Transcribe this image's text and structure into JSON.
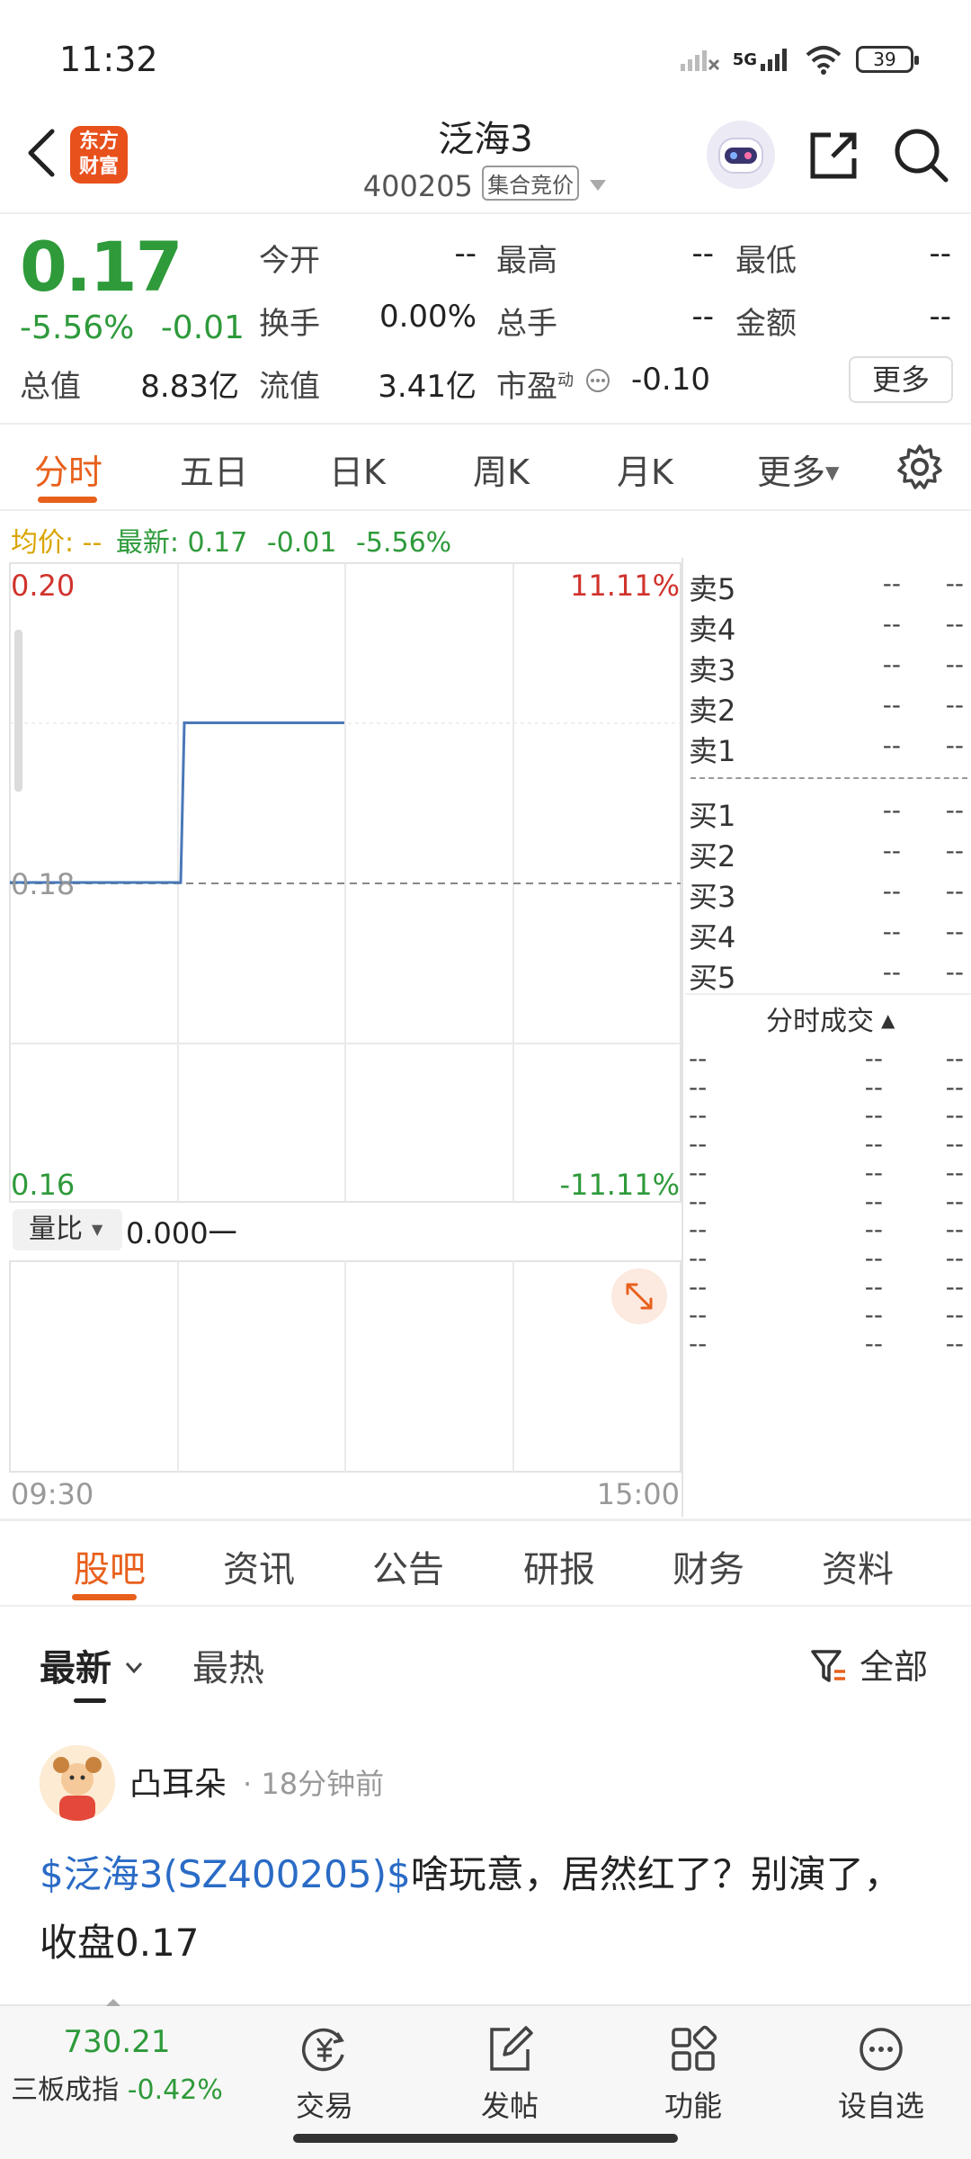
{
  "status_bar": {
    "time": "11:32",
    "network": "5G",
    "battery": "39"
  },
  "header": {
    "logo_line1": "东方",
    "logo_line2": "财富",
    "title": "泛海3",
    "code": "400205",
    "mode_tag": "集合竞价"
  },
  "quote": {
    "price": "0.17",
    "change_pct": "-5.56%",
    "change_amt": "-0.01",
    "fields": {
      "open_label": "今开",
      "open_value": "--",
      "high_label": "最高",
      "high_value": "--",
      "low_label": "最低",
      "low_value": "--",
      "turnover_label": "换手",
      "turnover_value": "0.00%",
      "volume_label": "总手",
      "volume_value": "--",
      "amount_label": "金额",
      "amount_value": "--",
      "mktcap_label": "总值",
      "mktcap_value": "8.83亿",
      "float_label": "流值",
      "float_value": "3.41亿",
      "pe_label": "市盈",
      "pe_sup": "动",
      "pe_value": "-0.10"
    },
    "more_label": "更多"
  },
  "chart_tabs": [
    "分时",
    "五日",
    "日K",
    "周K",
    "月K",
    "更多"
  ],
  "info_line": {
    "avg_label": "均价:",
    "avg_value": "--",
    "latest_label": "最新:",
    "latest_value": "0.17",
    "latest_change": "-0.01",
    "latest_pct": "-5.56%"
  },
  "chart_data": {
    "type": "line",
    "x": [
      "09:30",
      "09:30",
      "10:30",
      "11:30"
    ],
    "series": [
      {
        "values": [
          0.18,
          0.19,
          0.19,
          0.19
        ]
      }
    ],
    "ylim": [
      0.16,
      0.2
    ],
    "y_tick_labels_left": [
      "0.20",
      "0.18",
      "0.16"
    ],
    "y_tick_labels_right": [
      "11.11%",
      "-11.11%"
    ],
    "reference_value": 0.18,
    "x_tick_labels": [
      "09:30",
      "15:00"
    ],
    "grid": true
  },
  "volume_panel": {
    "label": "量比",
    "value": "0.000",
    "suffix": "一"
  },
  "order_book": {
    "asks": [
      {
        "label": "卖5",
        "price": "--",
        "qty": "--"
      },
      {
        "label": "卖4",
        "price": "--",
        "qty": "--"
      },
      {
        "label": "卖3",
        "price": "--",
        "qty": "--"
      },
      {
        "label": "卖2",
        "price": "--",
        "qty": "--"
      },
      {
        "label": "卖1",
        "price": "--",
        "qty": "--"
      }
    ],
    "bids": [
      {
        "label": "买1",
        "price": "--",
        "qty": "--"
      },
      {
        "label": "买2",
        "price": "--",
        "qty": "--"
      },
      {
        "label": "买3",
        "price": "--",
        "qty": "--"
      },
      {
        "label": "买4",
        "price": "--",
        "qty": "--"
      },
      {
        "label": "买5",
        "price": "--",
        "qty": "--"
      }
    ],
    "trades_title": "分时成交",
    "trades": [
      [
        "--",
        "--",
        "--"
      ],
      [
        "--",
        "--",
        "--"
      ],
      [
        "--",
        "--",
        "--"
      ],
      [
        "--",
        "--",
        "--"
      ],
      [
        "--",
        "--",
        "--"
      ],
      [
        "--",
        "--",
        "--"
      ],
      [
        "--",
        "--",
        "--"
      ],
      [
        "--",
        "--",
        "--"
      ],
      [
        "--",
        "--",
        "--"
      ],
      [
        "--",
        "--",
        "--"
      ],
      [
        "--",
        "--",
        "--"
      ]
    ]
  },
  "content_tabs": [
    "股吧",
    "资讯",
    "公告",
    "研报",
    "财务",
    "资料"
  ],
  "feed": {
    "sort_new": "最新",
    "sort_hot": "最热",
    "filter_label": "全部",
    "post": {
      "user": "凸耳朵",
      "time": "18分钟前",
      "link_text": "$泛海3(SZ400205)$",
      "text": "啥玩意，居然红了？别演了，收盘0.17"
    }
  },
  "bottom_nav": {
    "index_value": "730.21",
    "index_name": "三板成指",
    "index_change": "-0.42%",
    "items": [
      "交易",
      "发帖",
      "功能",
      "设自选"
    ]
  },
  "colors": {
    "down": "#2e9a3a",
    "up": "#d0332c",
    "accent": "#e8601c",
    "line": "#4a78b8"
  }
}
